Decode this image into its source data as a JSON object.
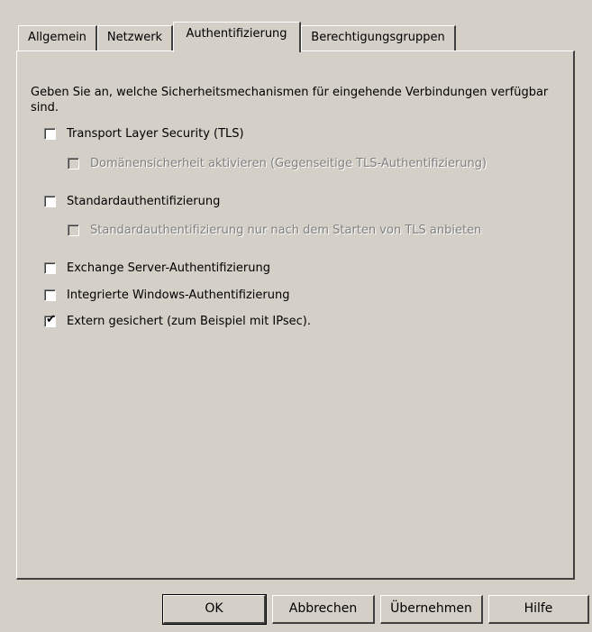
{
  "tabs": [
    {
      "label": "Allgemein"
    },
    {
      "label": "Netzwerk"
    },
    {
      "label": "Authentifizierung"
    },
    {
      "label": "Berechtigungsgruppen"
    }
  ],
  "active_tab": "Authentifizierung",
  "intro_text": "Geben Sie an, welche Sicherheitsmechanismen für eingehende Verbindungen verfügbar sind.",
  "options": {
    "tls": {
      "label": "Transport Layer Security (TLS)",
      "checked": false,
      "enabled": true
    },
    "domain_security": {
      "label": "Domänensicherheit aktivieren (Gegenseitige TLS-Authentifizierung)",
      "checked": false,
      "enabled": false
    },
    "basic_auth": {
      "label": "Standardauthentifizierung",
      "checked": false,
      "enabled": true
    },
    "basic_after_tls": {
      "label": "Standardauthentifizierung nur nach dem Starten von TLS anbieten",
      "checked": false,
      "enabled": false
    },
    "exchange_auth": {
      "label": "Exchange Server-Authentifizierung",
      "checked": false,
      "enabled": true
    },
    "windows_auth": {
      "label": "Integrierte Windows-Authentifizierung",
      "checked": false,
      "enabled": true
    },
    "externally_secured": {
      "label": "Extern gesichert (zum Beispiel mit IPsec).",
      "checked": true,
      "enabled": true
    }
  },
  "buttons": {
    "ok": "OK",
    "cancel": "Abbrechen",
    "apply": "Übernehmen",
    "help": "Hilfe"
  },
  "colors": {
    "dialog_bg": "#d4d0c8",
    "disabled_text": "#808080"
  }
}
